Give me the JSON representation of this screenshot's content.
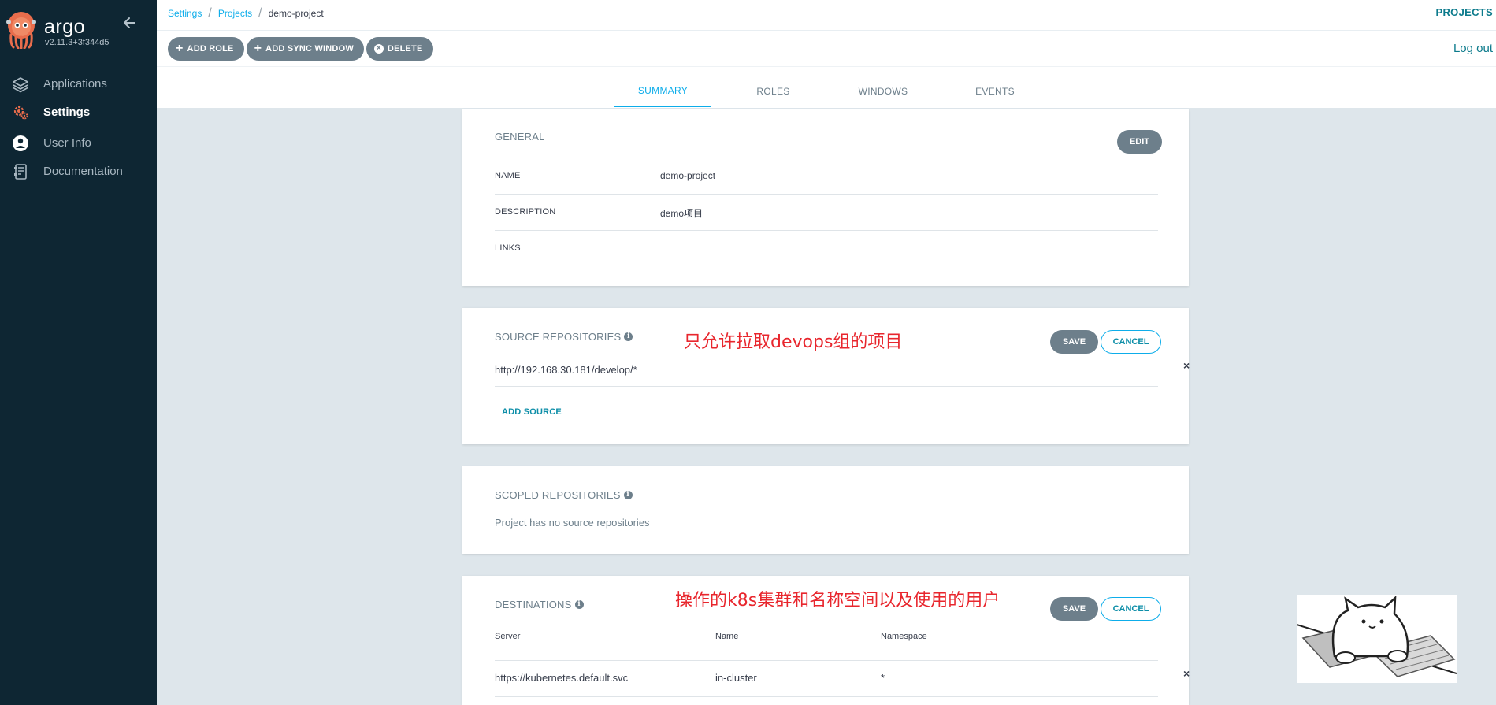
{
  "sidebar": {
    "logo_text": "argo",
    "version": "v2.11.3+3f344d5",
    "items": [
      {
        "label": "Applications",
        "icon": "layers-icon",
        "active": false
      },
      {
        "label": "Settings",
        "icon": "gear-icon",
        "active": true
      },
      {
        "label": "User Info",
        "icon": "user-icon",
        "active": false
      },
      {
        "label": "Documentation",
        "icon": "book-icon",
        "active": false
      }
    ]
  },
  "header": {
    "breadcrumb": [
      "Settings",
      "Projects",
      "demo-project"
    ],
    "page_title": "PROJECTS",
    "logout": "Log out",
    "toolbar": {
      "add_role": "ADD ROLE",
      "add_sync_window": "ADD SYNC WINDOW",
      "delete": "DELETE"
    },
    "tabs": [
      "SUMMARY",
      "ROLES",
      "WINDOWS",
      "EVENTS"
    ],
    "active_tab": "SUMMARY"
  },
  "general": {
    "title": "GENERAL",
    "edit": "EDIT",
    "rows": [
      {
        "label": "NAME",
        "value": "demo-project"
      },
      {
        "label": "DESCRIPTION",
        "value": "demo项目"
      },
      {
        "label": "LINKS",
        "value": ""
      }
    ]
  },
  "source_repos": {
    "title": "SOURCE REPOSITORIES",
    "annotation": "只允许拉取devops组的项目",
    "save": "SAVE",
    "cancel": "CANCEL",
    "repo": "http://192.168.30.181/develop/*",
    "add_source": "ADD SOURCE"
  },
  "scoped_repos": {
    "title": "SCOPED REPOSITORIES",
    "empty_text": "Project has no source repositories"
  },
  "destinations": {
    "title": "DESTINATIONS",
    "annotation": "操作的k8s集群和名称空间以及使用的用户",
    "save": "SAVE",
    "cancel": "CANCEL",
    "columns": [
      "Server",
      "Name",
      "Namespace"
    ],
    "rows": [
      {
        "server": "https://kubernetes.default.svc",
        "name": "in-cluster",
        "namespace": "*"
      }
    ]
  },
  "colors": {
    "sidebar_bg": "#0e2633",
    "accent": "#0dadea",
    "button_gray": "#6d7f8b",
    "annotation_red": "#e8262d"
  }
}
